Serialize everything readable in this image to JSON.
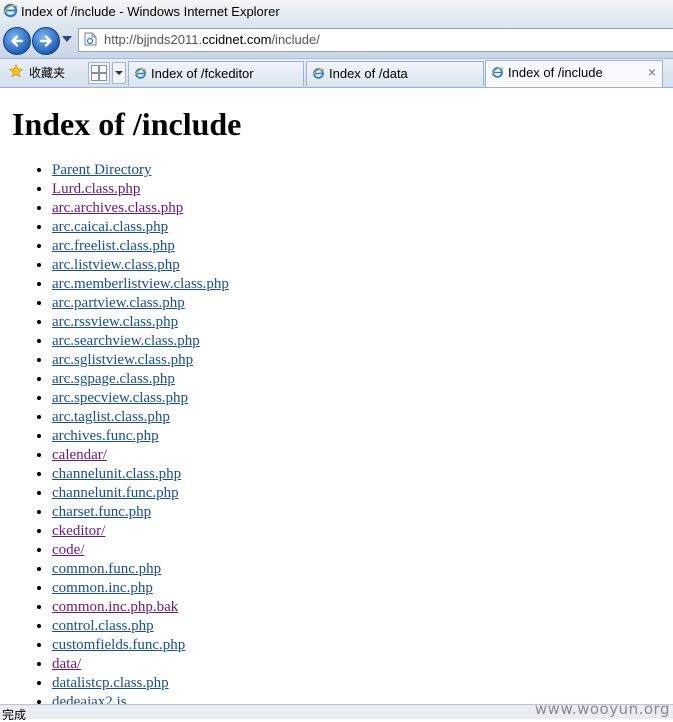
{
  "window": {
    "title": "Index of /include - Windows Internet Explorer"
  },
  "address_bar": {
    "url_prefix": "http://bjjnds2011.",
    "url_domain": "ccidnet.com",
    "url_suffix": "/include/"
  },
  "favorites": {
    "label": "收藏夹"
  },
  "tabs": [
    {
      "label": "Index of /fckeditor",
      "active": false
    },
    {
      "label": "Index of /data",
      "active": false
    },
    {
      "label": "Index of /include",
      "active": true,
      "close": "×"
    }
  ],
  "page": {
    "heading": "Index of /include",
    "entries": [
      {
        "name": "Parent Directory",
        "visited": false
      },
      {
        "name": "Lurd.class.php",
        "visited": true
      },
      {
        "name": "arc.archives.class.php",
        "visited": true
      },
      {
        "name": "arc.caicai.class.php",
        "visited": false
      },
      {
        "name": "arc.freelist.class.php",
        "visited": false
      },
      {
        "name": "arc.listview.class.php",
        "visited": false
      },
      {
        "name": "arc.memberlistview.class.php",
        "visited": false
      },
      {
        "name": "arc.partview.class.php",
        "visited": false
      },
      {
        "name": "arc.rssview.class.php",
        "visited": false
      },
      {
        "name": "arc.searchview.class.php",
        "visited": false
      },
      {
        "name": "arc.sglistview.class.php",
        "visited": false
      },
      {
        "name": "arc.sgpage.class.php",
        "visited": false
      },
      {
        "name": "arc.specview.class.php",
        "visited": false
      },
      {
        "name": "arc.taglist.class.php",
        "visited": false
      },
      {
        "name": "archives.func.php",
        "visited": false
      },
      {
        "name": "calendar/",
        "visited": true
      },
      {
        "name": "channelunit.class.php",
        "visited": false
      },
      {
        "name": "channelunit.func.php",
        "visited": false
      },
      {
        "name": "charset.func.php",
        "visited": false
      },
      {
        "name": "ckeditor/",
        "visited": true
      },
      {
        "name": "code/",
        "visited": true
      },
      {
        "name": "common.func.php",
        "visited": false
      },
      {
        "name": "common.inc.php",
        "visited": false
      },
      {
        "name": "common.inc.php.bak",
        "visited": true
      },
      {
        "name": "control.class.php",
        "visited": false
      },
      {
        "name": "customfields.func.php",
        "visited": false
      },
      {
        "name": "data/",
        "visited": true
      },
      {
        "name": "datalistcp.class.php",
        "visited": false
      },
      {
        "name": "dedeajax2.js",
        "visited": false
      }
    ]
  },
  "status_bar": {
    "text": "完成"
  },
  "watermark": "www.wooyun.org",
  "colors": {
    "link": "#1a4f8f",
    "visited_link": "#6b1a7a"
  }
}
